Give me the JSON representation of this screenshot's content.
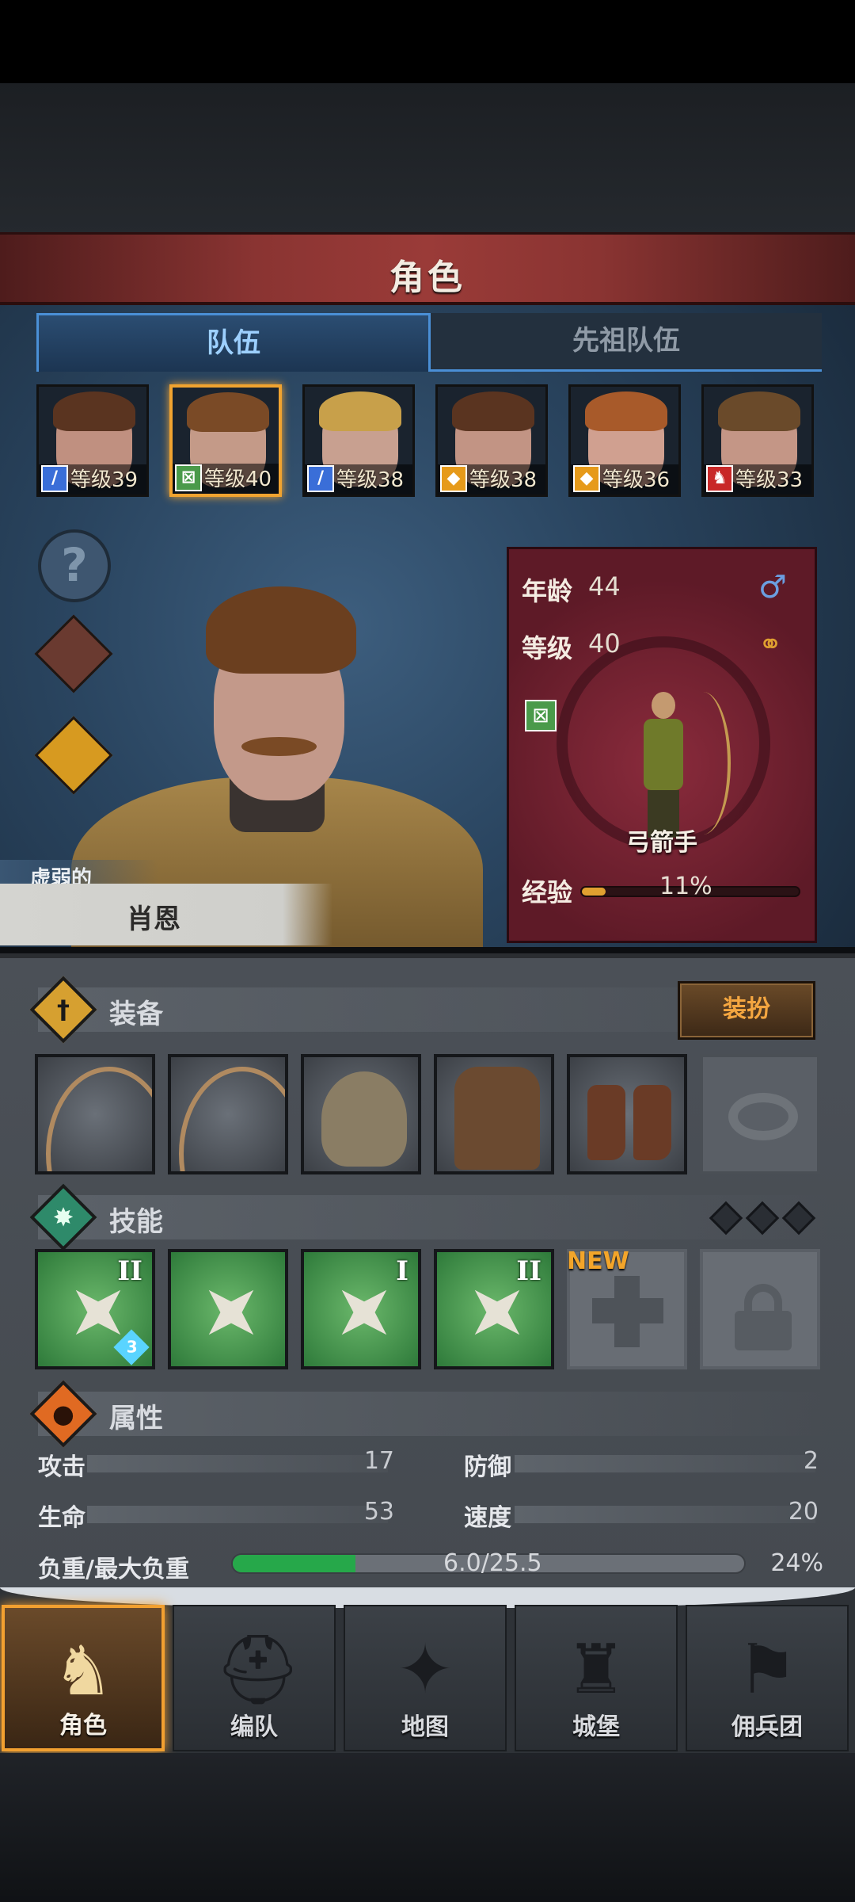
{
  "header": {
    "title": "角色"
  },
  "tabs": [
    {
      "label": "队伍",
      "active": true
    },
    {
      "label": "先祖队伍",
      "active": false
    }
  ],
  "roster": [
    {
      "level": "等级39",
      "class_icon": "sword-icon",
      "class_color": "#3a6ed8",
      "hair": "#5a3420",
      "skin": "#c09080",
      "selected": false
    },
    {
      "level": "等级40",
      "class_icon": "bow-icon",
      "class_color": "#4a9a4a",
      "hair": "#7a4a26",
      "skin": "#c49a88",
      "selected": true
    },
    {
      "level": "等级38",
      "class_icon": "sword-icon",
      "class_color": "#3a6ed8",
      "hair": "#c8a04a",
      "skin": "#c8a090",
      "selected": false
    },
    {
      "level": "等级38",
      "class_icon": "shield-icon",
      "class_color": "#e69a1a",
      "hair": "#5a3420",
      "skin": "#c29484",
      "selected": false
    },
    {
      "level": "等级36",
      "class_icon": "shield-icon",
      "class_color": "#e69a1a",
      "hair": "#a85a2a",
      "skin": "#d0a090",
      "selected": false
    },
    {
      "level": "等级33",
      "class_icon": "horse-icon",
      "class_color": "#c82828",
      "hair": "#6a4a2a",
      "skin": "#c49686",
      "selected": false
    }
  ],
  "hero": {
    "status": "虚弱的",
    "name": "肖恩"
  },
  "info": {
    "age_label": "年龄",
    "age": "44",
    "level_label": "等级",
    "level": "40",
    "class_name": "弓箭手",
    "xp_label": "经验",
    "xp_percent": "11%",
    "xp_fraction": 0.11,
    "gender_icon": "male-icon",
    "marriage_icon": "rings-icon"
  },
  "equipment": {
    "title": "装备",
    "dress_button": "装扮",
    "slots": [
      "bow",
      "bow",
      "hood",
      "coat",
      "boots",
      "ring-empty"
    ]
  },
  "skills": {
    "title": "技能",
    "new_label": "NEW",
    "items": [
      {
        "tier": "II",
        "gem": "3"
      },
      {
        "tier": "",
        "gem": ""
      },
      {
        "tier": "I",
        "gem": ""
      },
      {
        "tier": "II",
        "gem": ""
      }
    ]
  },
  "attributes": {
    "title": "属性",
    "attack_label": "攻击",
    "attack": "17",
    "defense_label": "防御",
    "defense": "2",
    "hp_label": "生命",
    "hp": "53",
    "speed_label": "速度",
    "speed": "20",
    "load_label": "负重/最大负重",
    "load_value": "6.0/25.5",
    "load_percent": "24%",
    "load_fraction": 0.24
  },
  "nav": [
    {
      "label": "角色",
      "icon": "knight-icon",
      "active": true
    },
    {
      "label": "编队",
      "icon": "helmet-icon",
      "active": false
    },
    {
      "label": "地图",
      "icon": "compass-map-icon",
      "active": false
    },
    {
      "label": "城堡",
      "icon": "castle-icon",
      "active": false
    },
    {
      "label": "佣兵团",
      "icon": "banner-icon",
      "active": false
    }
  ]
}
